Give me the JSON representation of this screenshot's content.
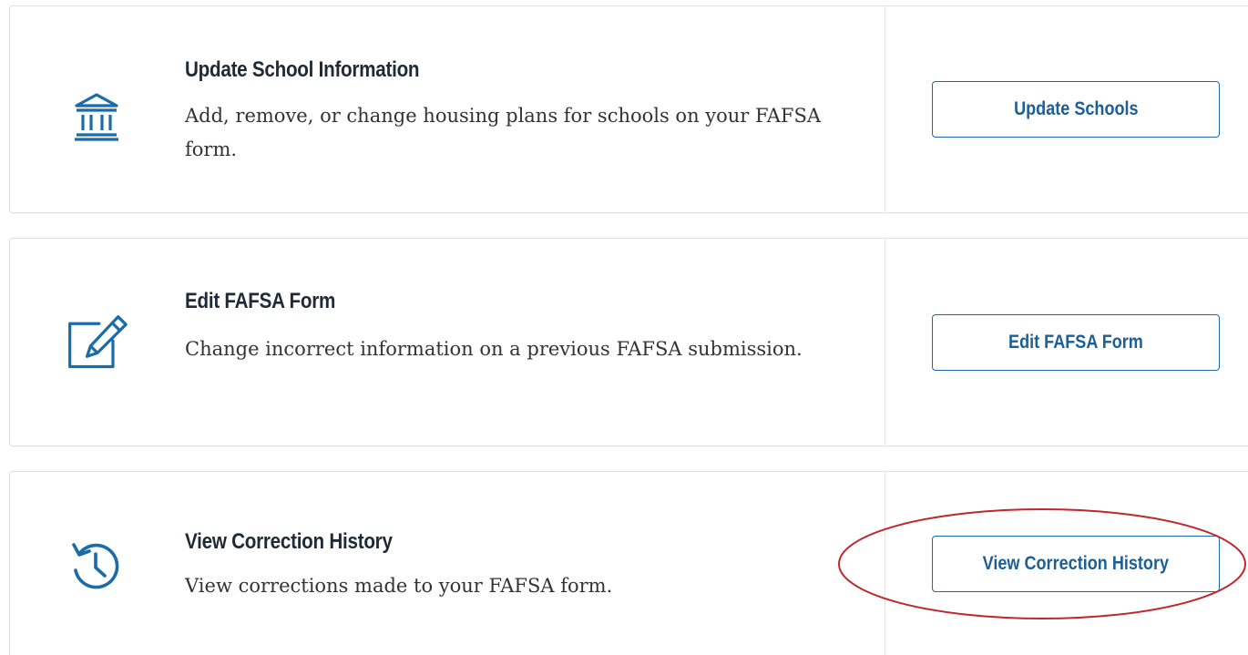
{
  "cards": [
    {
      "title": "Update School Information",
      "description": "Add, remove, or change housing plans for schools on your FAFSA form.",
      "icon": "bank-icon",
      "button_label": "Update Schools"
    },
    {
      "title": "Edit FAFSA Form",
      "description": "Change incorrect information on a previous FAFSA submission.",
      "icon": "edit-icon",
      "button_label": "Edit FAFSA Form"
    },
    {
      "title": "View Correction History",
      "description": "View corrections made to your FAFSA form.",
      "icon": "history-icon",
      "button_label": "View Correction History"
    }
  ],
  "colors": {
    "accent": "#1b6ba8",
    "annotation": "#c0272d",
    "title_text": "#1f2a37",
    "body_text": "#333333"
  }
}
